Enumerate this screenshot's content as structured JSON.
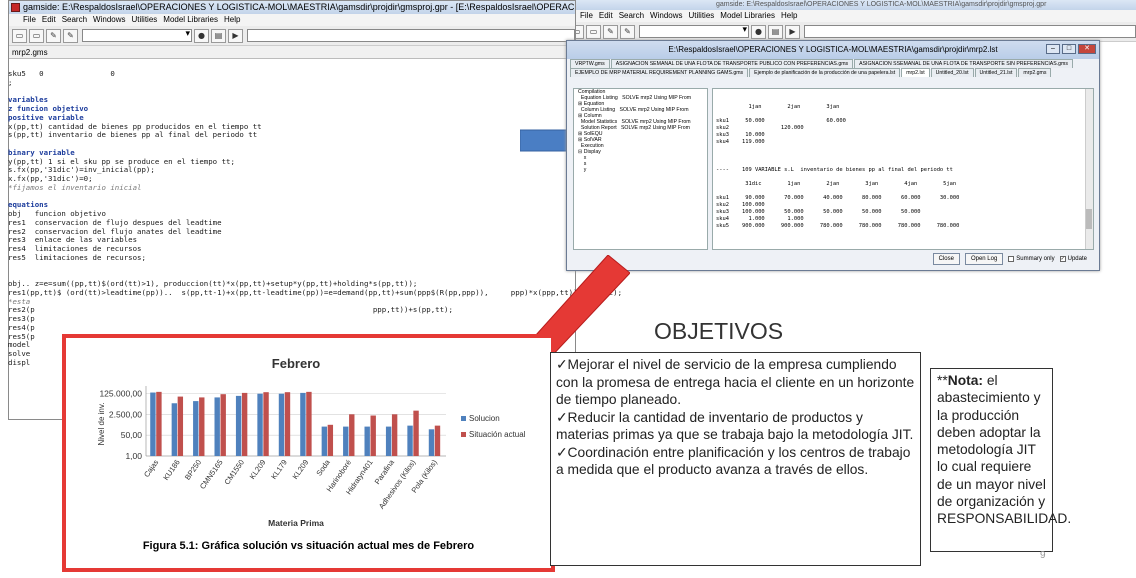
{
  "gams_window": {
    "title": "gamside: E:\\RespaldosIsrael\\OPERACIONES Y LOGISTICA-MOL\\MAESTRIA\\gamsdir\\projdir\\gmsproj.gpr - [E:\\RespaldosIsrael\\OPERACIONES",
    "menu": [
      "File",
      "Edit",
      "Search",
      "Windows",
      "Utilities",
      "Model Libraries",
      "Help"
    ],
    "file_tab": "mrp2.gms"
  },
  "gams_window_right": {
    "title": "gamside: E:\\RespaldosIsrael\\OPERACIONES Y LOGISTICA-MOL\\MAESTRIA\\gamsdir\\projdir\\gmsproj.gpr",
    "menu": [
      "File",
      "Edit",
      "Search",
      "Windows",
      "Utilities",
      "Model Libraries",
      "Help"
    ]
  },
  "code_lines": [
    {
      "t": "sku5   0               0",
      "c": "n"
    },
    {
      "t": ";",
      "c": "n"
    },
    {
      "t": "",
      "c": "n"
    },
    {
      "t": "variables",
      "c": "k"
    },
    {
      "t": "z funcion objetivo",
      "c": "k"
    },
    {
      "t": "positive variable",
      "c": "k"
    },
    {
      "t": "x(pp,tt) cantidad de bienes pp producidos en el tiempo tt",
      "c": "n"
    },
    {
      "t": "s(pp,tt) inventario de bienes pp al final del periodo tt",
      "c": "n"
    },
    {
      "t": "",
      "c": "n"
    },
    {
      "t": "binary variable",
      "c": "k"
    },
    {
      "t": "y(pp,tt) 1 si el sku pp se produce en el tiempo tt;",
      "c": "n"
    },
    {
      "t": "s.fx(pp,'31dic')=inv_inicial(pp);",
      "c": "n"
    },
    {
      "t": "x.fx(pp,'31dic')=0;",
      "c": "n"
    },
    {
      "t": "*fijamos el inventario inicial",
      "c": "c"
    },
    {
      "t": "",
      "c": "n"
    },
    {
      "t": "equations",
      "c": "k"
    },
    {
      "t": "obj   funcion objetivo",
      "c": "n"
    },
    {
      "t": "res1  conservacion de flujo despues del leadtime",
      "c": "n"
    },
    {
      "t": "res2  conservacion del flujo anates del leadtime",
      "c": "n"
    },
    {
      "t": "res3  enlace de las variables",
      "c": "n"
    },
    {
      "t": "res4  limitaciones de recursos",
      "c": "n"
    },
    {
      "t": "res5  limitaciones de recursos;",
      "c": "n"
    },
    {
      "t": "",
      "c": "n"
    },
    {
      "t": "",
      "c": "n"
    },
    {
      "t": "obj.. z=e=sum((pp,tt)$(ord(tt)>1), produccion(tt)*x(pp,tt)+setup*y(pp,tt)+holding*s(pp,tt));",
      "c": "n"
    },
    {
      "t": "res1(pp,tt)$ (ord(tt)>leadtime(pp))..  s(pp,tt-1)+x(pp,tt-leadtime(pp))=e=demand(pp,tt)+sum(ppp$(R(pp,ppp)),     ppp)*x(ppp,tt))+s(pp,tt);",
      "c": "n"
    },
    {
      "t": "*esta",
      "c": "c"
    },
    {
      "t": "res2(p                                                                            ppp,tt))+s(pp,tt);",
      "c": "n"
    },
    {
      "t": "res3(p",
      "c": "n"
    },
    {
      "t": "res4(p",
      "c": "n"
    },
    {
      "t": "res5(p",
      "c": "n"
    },
    {
      "t": "model",
      "c": "n"
    },
    {
      "t": "solve",
      "c": "n"
    },
    {
      "t": "displ",
      "c": "n"
    }
  ],
  "lst_window": {
    "title": "E:\\RespaldosIsrael\\OPERACIONES Y LOGISTICA-MOL\\MAESTRIA\\gamsdir\\projdir\\mrp2.lst",
    "tabs_row1": [
      "VRPTW.gms",
      "ASIGNACION SEMANAL DE UNA FLOTA DE TRANSPORTE PUBLICO CON PREFERENCIAS.gms",
      "ASIGNACION SSEMANAL DE UNA FLOTA DE TRANSPORTE SIN PREFERENCIAS.gms"
    ],
    "tabs_row2": [
      "EJEMPLO DE MRP MATERIAL REQUIREMENT PLANNING GAMS.gms",
      "Ejemplo de planificación de la producción de una papelera.lst",
      "mrp2.lst",
      "Untitled_20.lst",
      "Untitled_21.lst",
      "mrp2.gms"
    ],
    "tree": [
      "Compilation",
      "  Equation Listing   SOLVE mrp2 Using MIP From",
      "⊞ Equation",
      "  Column Listing   SOLVE mrp2 Using MIP From",
      "⊞ Column",
      "  Model Statistics   SOLVE mrp2 Using MIP From",
      "  Solution Report   SOLVE mrp2 Using MIP From",
      "⊞ SolEQU",
      "⊞ SolVAR",
      "  Execution",
      "⊟ Display",
      "    x",
      "    s",
      "    y"
    ],
    "output_lines": [
      "          1jan        2jan        3jan",
      "",
      "sku1     50.000                   60.000",
      "sku2                120.000",
      "sku3     10.000",
      "sku4    119.000",
      "",
      "",
      "",
      "----    109 VARIABLE s.L  inventario de bienes pp al final del periodo tt",
      "",
      "         31dic        1jan        2jan        3jan        4jan        5jan",
      "",
      "sku1     90.000      70.000      40.000      80.000      60.000      30.000",
      "sku2    100.000",
      "sku3    100.000      50.000      50.000      50.000      50.000",
      "sku4      1.000       1.000",
      "sku5    900.000     900.000     780.000     780.000     780.000     780.000"
    ],
    "close_label": "Close",
    "open_log_label": "Open Log",
    "summary_label": "Summary only",
    "update_label": "Update"
  },
  "chart_data": {
    "type": "bar",
    "title": "Febrero",
    "xlabel": "Materia Prima",
    "ylabel": "Nivel de inv.",
    "yscale": "log",
    "yticks": [
      "125.000,00",
      "2.500,00",
      "50,00",
      "1,00"
    ],
    "categories": [
      "Cajas",
      "KU186",
      "BP250",
      "CMN5165",
      "CM1550",
      "KL2091",
      "KL1791",
      "KL2091b",
      "Soda",
      "Harinoboré",
      "Hidratyn401",
      "Parafina",
      "Adhesivos (Kilos)",
      "Pola (Kilos)"
    ],
    "category_labels_visible": [
      "Cajas",
      "KU186",
      "BP250",
      "CMN5165",
      "CM1550",
      "KL209",
      "KL179",
      "KL209",
      "Soda",
      "Harinoboré",
      "Hidratyn401",
      "Parafina",
      "Adhesivos (Kilos)",
      "Pola (Kilos)"
    ],
    "series": [
      {
        "name": "Solucion",
        "color": "#4f81bd",
        "values": [
          150000,
          20000,
          30000,
          60000,
          80000,
          120000,
          120000,
          140000,
          250,
          250,
          250,
          250,
          300,
          150
        ]
      },
      {
        "name": "Situación actual",
        "color": "#c0504d",
        "values": [
          170000,
          70000,
          60000,
          110000,
          140000,
          160000,
          160000,
          170000,
          350,
          2500,
          2000,
          2500,
          5000,
          300
        ]
      }
    ],
    "legend_position": "right"
  },
  "chart_caption": "Figura 5.1: Gráfica solución vs situación actual mes de Febrero",
  "objetivos": {
    "title": "OBJETIVOS",
    "items": [
      "✓Mejorar el nivel de servicio de la empresa cumpliendo con la promesa de entrega hacia el cliente en un horizonte de tiempo planeado.",
      "✓Reducir la cantidad de inventario de productos y materias primas ya que se trabaja bajo la metodología JIT.",
      "✓Coordinación entre planificación y los centros de trabajo a medida que el producto avanza a través de ellos."
    ]
  },
  "nota": {
    "prefix": "**",
    "label": "Nota:",
    "text": " el abastecimiento y la producción deben adoptar la metodología JIT lo cual requiere de un mayor nivel de organización y RESPONSABILIDAD."
  },
  "page_number": "9",
  "colors": {
    "arrow_blue": "#4a7ec4",
    "red": "#e53935"
  }
}
